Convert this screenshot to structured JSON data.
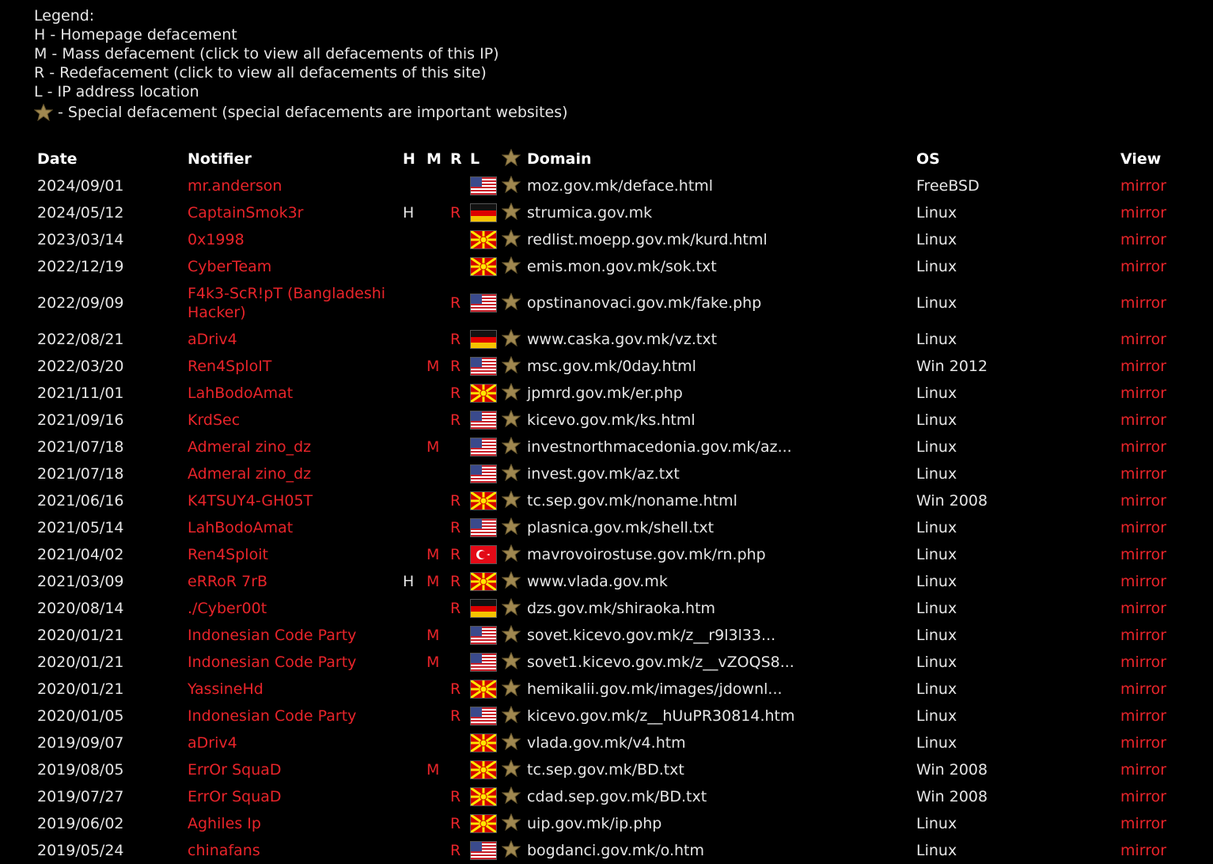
{
  "legend": {
    "title": "Legend:",
    "h": "H - Homepage defacement",
    "m": "M - Mass defacement (click to view all defacements of this IP)",
    "r": "R - Redefacement (click to view all defacements of this site)",
    "l": "L - IP address location",
    "special": "- Special defacement (special defacements are important websites)"
  },
  "columns": {
    "date": "Date",
    "notifier": "Notifier",
    "h": "H",
    "m": "M",
    "r": "R",
    "l": "L",
    "domain": "Domain",
    "os": "OS",
    "view": "View"
  },
  "rows": [
    {
      "date": "2024/09/01",
      "notifier": "mr.anderson",
      "h": "",
      "m": "",
      "r": "",
      "flag": "us",
      "domain": "moz.gov.mk/deface.html",
      "os": "FreeBSD",
      "view": "mirror"
    },
    {
      "date": "2024/05/12",
      "notifier": "CaptainSmok3r",
      "h": "H",
      "m": "",
      "r": "R",
      "flag": "de",
      "domain": "strumica.gov.mk",
      "os": "Linux",
      "view": "mirror"
    },
    {
      "date": "2023/03/14",
      "notifier": "0x1998",
      "h": "",
      "m": "",
      "r": "",
      "flag": "mk",
      "domain": "redlist.moepp.gov.mk/kurd.html",
      "os": "Linux",
      "view": "mirror"
    },
    {
      "date": "2022/12/19",
      "notifier": "CyberTeam",
      "h": "",
      "m": "",
      "r": "",
      "flag": "mk",
      "domain": "emis.mon.gov.mk/sok.txt",
      "os": "Linux",
      "view": "mirror"
    },
    {
      "date": "2022/09/09",
      "notifier": "F4k3-ScR!pT (Bangladeshi Hacker)",
      "h": "",
      "m": "",
      "r": "R",
      "flag": "us",
      "domain": "opstinanovaci.gov.mk/fake.php",
      "os": "Linux",
      "view": "mirror",
      "tall": true
    },
    {
      "date": "2022/08/21",
      "notifier": "aDriv4",
      "h": "",
      "m": "",
      "r": "R",
      "flag": "de",
      "domain": "www.caska.gov.mk/vz.txt",
      "os": "Linux",
      "view": "mirror"
    },
    {
      "date": "2022/03/20",
      "notifier": "Ren4SploIT",
      "h": "",
      "m": "M",
      "r": "R",
      "flag": "us",
      "domain": "msc.gov.mk/0day.html",
      "os": "Win 2012",
      "view": "mirror"
    },
    {
      "date": "2021/11/01",
      "notifier": "LahBodoAmat",
      "h": "",
      "m": "",
      "r": "R",
      "flag": "mk",
      "domain": "jpmrd.gov.mk/er.php",
      "os": "Linux",
      "view": "mirror"
    },
    {
      "date": "2021/09/16",
      "notifier": "KrdSec",
      "h": "",
      "m": "",
      "r": "R",
      "flag": "us",
      "domain": "kicevo.gov.mk/ks.html",
      "os": "Linux",
      "view": "mirror"
    },
    {
      "date": "2021/07/18",
      "notifier": "Admeral zino_dz",
      "h": "",
      "m": "M",
      "r": "",
      "flag": "us",
      "domain": "investnorthmacedonia.gov.mk/az...",
      "os": "Linux",
      "view": "mirror"
    },
    {
      "date": "2021/07/18",
      "notifier": "Admeral zino_dz",
      "h": "",
      "m": "",
      "r": "",
      "flag": "us",
      "domain": "invest.gov.mk/az.txt",
      "os": "Linux",
      "view": "mirror"
    },
    {
      "date": "2021/06/16",
      "notifier": "K4TSUY4-GH05T",
      "h": "",
      "m": "",
      "r": "R",
      "flag": "mk",
      "domain": "tc.sep.gov.mk/noname.html",
      "os": "Win 2008",
      "view": "mirror"
    },
    {
      "date": "2021/05/14",
      "notifier": "LahBodoAmat",
      "h": "",
      "m": "",
      "r": "R",
      "flag": "us",
      "domain": "plasnica.gov.mk/shell.txt",
      "os": "Linux",
      "view": "mirror"
    },
    {
      "date": "2021/04/02",
      "notifier": "Ren4Sploit",
      "h": "",
      "m": "M",
      "r": "R",
      "flag": "tr",
      "domain": "mavrovoirostuse.gov.mk/rn.php",
      "os": "Linux",
      "view": "mirror"
    },
    {
      "date": "2021/03/09",
      "notifier": "eRRoR 7rB",
      "h": "H",
      "m": "M",
      "r": "R",
      "flag": "mk",
      "domain": "www.vlada.gov.mk",
      "os": "Linux",
      "view": "mirror"
    },
    {
      "date": "2020/08/14",
      "notifier": "./Cyber00t",
      "h": "",
      "m": "",
      "r": "R",
      "flag": "de",
      "domain": "dzs.gov.mk/shiraoka.htm",
      "os": "Linux",
      "view": "mirror"
    },
    {
      "date": "2020/01/21",
      "notifier": "Indonesian Code Party",
      "h": "",
      "m": "M",
      "r": "",
      "flag": "us",
      "domain": "sovet.kicevo.gov.mk/z__r9l3l33...",
      "os": "Linux",
      "view": "mirror"
    },
    {
      "date": "2020/01/21",
      "notifier": "Indonesian Code Party",
      "h": "",
      "m": "M",
      "r": "",
      "flag": "us",
      "domain": "sovet1.kicevo.gov.mk/z__vZOQS8...",
      "os": "Linux",
      "view": "mirror"
    },
    {
      "date": "2020/01/21",
      "notifier": "YassineHd",
      "h": "",
      "m": "",
      "r": "R",
      "flag": "mk",
      "domain": "hemikalii.gov.mk/images/jdownl...",
      "os": "Linux",
      "view": "mirror"
    },
    {
      "date": "2020/01/05",
      "notifier": "Indonesian Code Party",
      "h": "",
      "m": "",
      "r": "R",
      "flag": "us",
      "domain": "kicevo.gov.mk/z__hUuPR30814.htm",
      "os": "Linux",
      "view": "mirror"
    },
    {
      "date": "2019/09/07",
      "notifier": "aDriv4",
      "h": "",
      "m": "",
      "r": "",
      "flag": "mk",
      "domain": "vlada.gov.mk/v4.htm",
      "os": "Linux",
      "view": "mirror"
    },
    {
      "date": "2019/08/05",
      "notifier": "ErrOr SquaD",
      "h": "",
      "m": "M",
      "r": "",
      "flag": "mk",
      "domain": "tc.sep.gov.mk/BD.txt",
      "os": "Win 2008",
      "view": "mirror"
    },
    {
      "date": "2019/07/27",
      "notifier": "ErrOr SquaD",
      "h": "",
      "m": "",
      "r": "R",
      "flag": "mk",
      "domain": "cdad.sep.gov.mk/BD.txt",
      "os": "Win 2008",
      "view": "mirror"
    },
    {
      "date": "2019/06/02",
      "notifier": "Aghiles Ip",
      "h": "",
      "m": "",
      "r": "R",
      "flag": "mk",
      "domain": "uip.gov.mk/ip.php",
      "os": "Linux",
      "view": "mirror"
    },
    {
      "date": "2019/05/24",
      "notifier": "chinafans",
      "h": "",
      "m": "",
      "r": "R",
      "flag": "us",
      "domain": "bogdanci.gov.mk/o.htm",
      "os": "Linux",
      "view": "mirror"
    }
  ],
  "colors": {
    "background": "#000000",
    "text": "#e6e6e6",
    "link": "#e8242a"
  }
}
